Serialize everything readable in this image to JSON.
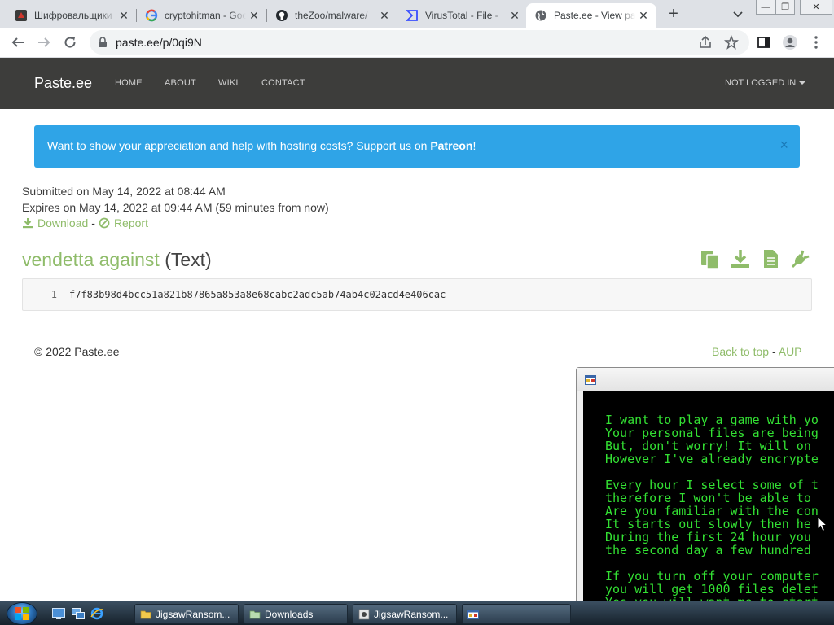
{
  "browser": {
    "tabs": [
      {
        "title": "Шифровальщики",
        "icon": "ransom-site-icon",
        "close": "✕"
      },
      {
        "title": "cryptohitman - Google",
        "icon": "google-icon",
        "close": "✕"
      },
      {
        "title": "theZoo/malware/",
        "icon": "github-icon",
        "close": "✕"
      },
      {
        "title": "VirusTotal - File -",
        "icon": "virustotal-icon",
        "close": "✕"
      },
      {
        "title": "Paste.ee - View paste",
        "icon": "globe-icon",
        "close": "✕",
        "active": true
      }
    ],
    "new_tab": "+",
    "address": "paste.ee/p/0qi9N",
    "window_controls": {
      "minimize": "—",
      "maximize": "❐",
      "close": "✕"
    }
  },
  "site": {
    "brand": "Paste.ee",
    "nav": [
      "HOME",
      "ABOUT",
      "WIKI",
      "CONTACT"
    ],
    "account": "NOT LOGGED IN"
  },
  "banner": {
    "text": "Want to show your appreciation and help with hosting costs? Support us on ",
    "link": "Patreon",
    "suffix": "!",
    "close": "×"
  },
  "paste": {
    "submitted": "Submitted on May 14, 2022 at 08:44 AM",
    "expires": "Expires on May 14, 2022 at 09:44 AM (59 minutes from now)",
    "download_label": "Download",
    "separator": "-",
    "report_label": "Report",
    "title": "vendetta against",
    "type": "(Text)",
    "lines": [
      {
        "number": "1",
        "text": "f7f83b98d4bcc51a821b87865a853a8e68cabc2adc5ab74ab4c02acd4e406cac"
      }
    ]
  },
  "footer": {
    "copyright": "© 2022 Paste.ee",
    "back_to_top": "Back to top",
    "separator": "-",
    "aup": "AUP"
  },
  "ransom_window": {
    "text": "I want to play a game with yo\nYour personal files are being\nBut, don't worry! It will on\nHowever I've already encrypte\n\nEvery hour I select some of t\ntherefore I won't be able to\nAre you familiar with the con\nIt starts out slowly then he\nDuring the first 24 hour you\nthe second day a few hundred\n\nIf you turn off your computer\nyou will get 1000 files delet\nYes you will want me to start\nis capable to decrypt your p"
  },
  "taskbar": {
    "buttons": [
      {
        "label": "JigsawRansom...",
        "icon": "folder-icon"
      },
      {
        "label": "Downloads",
        "icon": "folder-icon"
      },
      {
        "label": "JigsawRansom...",
        "icon": "program-icon"
      },
      {
        "label": "",
        "icon": "window-icon"
      }
    ]
  },
  "colors": {
    "nav_bg": "#3d3d3b",
    "banner_bg": "#2fa4e7",
    "accent_green": "#8fbc6a",
    "terminal_green": "#33e033"
  }
}
